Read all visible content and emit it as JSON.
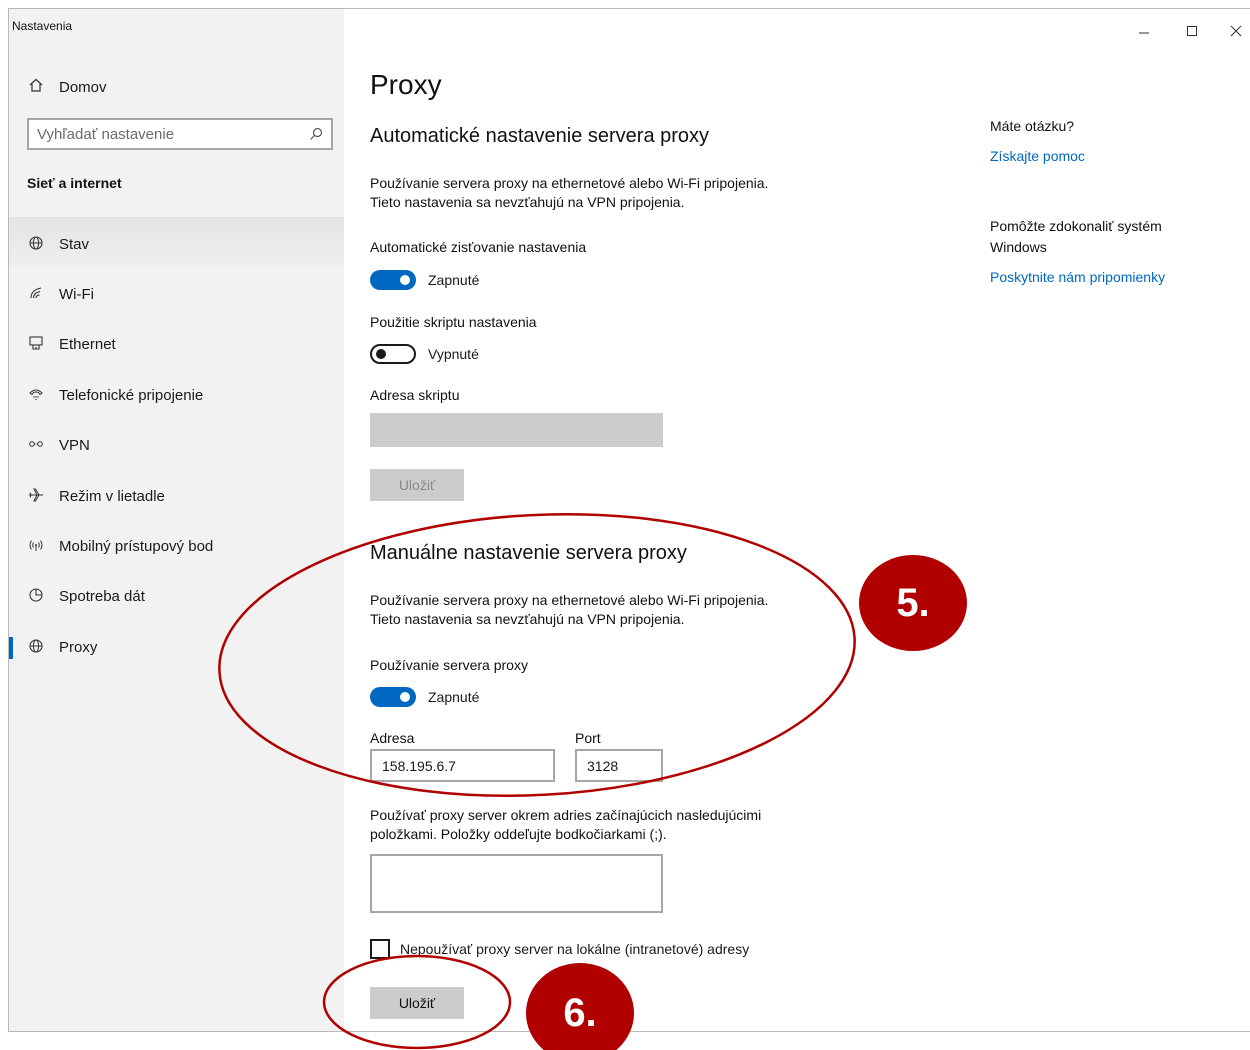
{
  "window": {
    "title": "Nastavenia",
    "controls": [
      "minimize",
      "maximize",
      "close"
    ]
  },
  "sidebar": {
    "home_label": "Domov",
    "search_placeholder": "Vyhľadať nastavenie",
    "section_title": "Sieť a internet",
    "items": [
      {
        "label": "Stav",
        "icon": "globe-status-icon"
      },
      {
        "label": "Wi-Fi",
        "icon": "wifi-icon"
      },
      {
        "label": "Ethernet",
        "icon": "ethernet-icon"
      },
      {
        "label": "Telefonické pripojenie",
        "icon": "dialup-icon"
      },
      {
        "label": "VPN",
        "icon": "vpn-icon"
      },
      {
        "label": "Režim v lietadle",
        "icon": "airplane-icon"
      },
      {
        "label": "Mobilný prístupový bod",
        "icon": "hotspot-icon"
      },
      {
        "label": "Spotreba dát",
        "icon": "data-usage-icon"
      },
      {
        "label": "Proxy",
        "icon": "globe-icon",
        "active": true
      }
    ]
  },
  "main": {
    "title": "Proxy",
    "auto": {
      "heading": "Automatické nastavenie servera proxy",
      "desc_line1": "Používanie servera proxy na ethernetové alebo Wi-Fi pripojenia.",
      "desc_line2": "Tieto nastavenia sa nevzťahujú na VPN pripojenia.",
      "detect_label": "Automatické zisťovanie nastavenia",
      "detect_state": "Zapnuté",
      "script_label": "Použitie skriptu nastavenia",
      "script_state": "Vypnuté",
      "script_address_label": "Adresa skriptu",
      "script_address_value": "",
      "save_label": "Uložiť"
    },
    "manual": {
      "heading": "Manuálne nastavenie servera proxy",
      "desc_line1": "Používanie servera proxy na ethernetové alebo Wi-Fi pripojenia.",
      "desc_line2": "Tieto nastavenia sa nevzťahujú na VPN pripojenia.",
      "use_proxy_label": "Používanie servera proxy",
      "use_proxy_state": "Zapnuté",
      "address_label": "Adresa",
      "address_value": "158.195.6.7",
      "port_label": "Port",
      "port_value": "3128",
      "exceptions_line1": "Používať proxy server okrem adries začínajúcich nasledujúcimi",
      "exceptions_line2": "položkami. Položky oddeľujte bodkočiarkami (;).",
      "exceptions_value": "",
      "local_bypass_label": "Nepoužívať proxy server na lokálne (intranetové) adresy",
      "local_bypass_checked": false,
      "save_label": "Uložiť"
    }
  },
  "help": {
    "question": "Máte otázku?",
    "get_help": "Získajte pomoc",
    "improve_line1": "Pomôžte zdokonaliť systém",
    "improve_line2": "Windows",
    "feedback": "Poskytnite nám pripomienky"
  },
  "annotations": {
    "step5": "5.",
    "step6": "6.",
    "color": "#b00000"
  }
}
